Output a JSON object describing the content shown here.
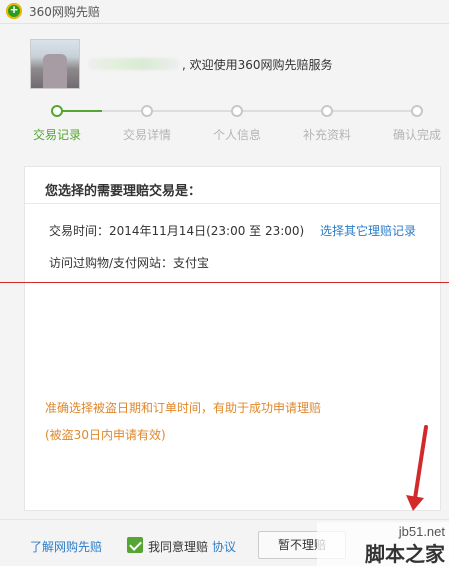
{
  "window": {
    "title": "360网购先赔",
    "logo_icon": "360-logo-icon"
  },
  "user": {
    "welcome_text": ", 欢迎使用360网购先赔服务"
  },
  "steps": [
    {
      "label": "交易记录",
      "active": true
    },
    {
      "label": "交易详情",
      "active": false
    },
    {
      "label": "个人信息",
      "active": false
    },
    {
      "label": "补充资料",
      "active": false
    },
    {
      "label": "确认完成",
      "active": false
    }
  ],
  "panel": {
    "title": "您选择的需要理赔交易是：",
    "trade_time": "交易时间：2014年11月14日(23:00 至 23:00)",
    "select_other": "选择其它理赔记录",
    "visited_site": "访问过购物/支付网站：支付宝",
    "tip_1": "准确选择被盗日期和订单时间，有助于成功申请理赔",
    "tip_2": "(被盗30日内申请有效)"
  },
  "footer": {
    "learn_link": "了解网购先赔",
    "agree_checked": true,
    "agree_text": "我同意理赔",
    "protocol_link": "协议",
    "later_button": "暂不理赔"
  },
  "watermark": {
    "url": "jb51.net",
    "name": "脚本之家"
  },
  "colors": {
    "accent_green": "#55a532",
    "link_blue": "#2c7dc9",
    "tip_orange": "#e0882c",
    "annotation_red": "#d22a2a"
  }
}
